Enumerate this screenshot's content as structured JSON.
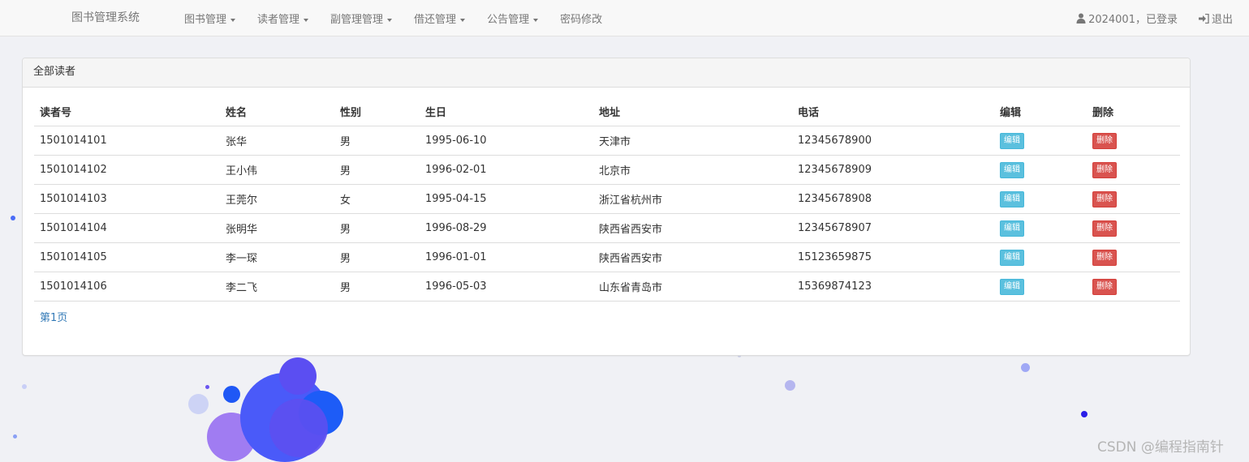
{
  "navbar": {
    "brand": "图书管理系统",
    "menu": [
      {
        "label": "图书管理",
        "dropdown": true
      },
      {
        "label": "读者管理",
        "dropdown": true
      },
      {
        "label": "副管理管理",
        "dropdown": true
      },
      {
        "label": "借还管理",
        "dropdown": true
      },
      {
        "label": "公告管理",
        "dropdown": true
      },
      {
        "label": "密码修改",
        "dropdown": false
      }
    ],
    "user_text": "2024001，已登录",
    "user_icon": "user-icon",
    "logout_label": "退出",
    "logout_icon": "log-in-icon"
  },
  "panel": {
    "title": "全部读者",
    "columns": [
      "读者号",
      "姓名",
      "性别",
      "生日",
      "地址",
      "电话",
      "编辑",
      "删除"
    ],
    "rows": [
      {
        "id": "1501014101",
        "name": "张华",
        "gender": "男",
        "birthday": "1995-06-10",
        "address": "天津市",
        "phone": "12345678900",
        "edit": "编辑",
        "delete": "删除"
      },
      {
        "id": "1501014102",
        "name": "王小伟",
        "gender": "男",
        "birthday": "1996-02-01",
        "address": "北京市",
        "phone": "12345678909",
        "edit": "编辑",
        "delete": "删除"
      },
      {
        "id": "1501014103",
        "name": "王莞尔",
        "gender": "女",
        "birthday": "1995-04-15",
        "address": "浙江省杭州市",
        "phone": "12345678908",
        "edit": "编辑",
        "delete": "删除"
      },
      {
        "id": "1501014104",
        "name": "张明华",
        "gender": "男",
        "birthday": "1996-08-29",
        "address": "陕西省西安市",
        "phone": "12345678907",
        "edit": "编辑",
        "delete": "删除"
      },
      {
        "id": "1501014105",
        "name": "李一琛",
        "gender": "男",
        "birthday": "1996-01-01",
        "address": "陕西省西安市",
        "phone": "15123659875",
        "edit": "编辑",
        "delete": "删除"
      },
      {
        "id": "1501014106",
        "name": "李二飞",
        "gender": "男",
        "birthday": "1996-05-03",
        "address": "山东省青岛市",
        "phone": "15369874123",
        "edit": "编辑",
        "delete": "删除"
      }
    ],
    "pager_label": "第1页"
  },
  "colors": {
    "edit_button": "#5bc0de",
    "delete_button": "#d9534f",
    "link": "#337ab7",
    "bubble_blue": "#3f4dff",
    "bubble_purple": "#9b6cf5"
  },
  "watermark": "CSDN @编程指南针"
}
